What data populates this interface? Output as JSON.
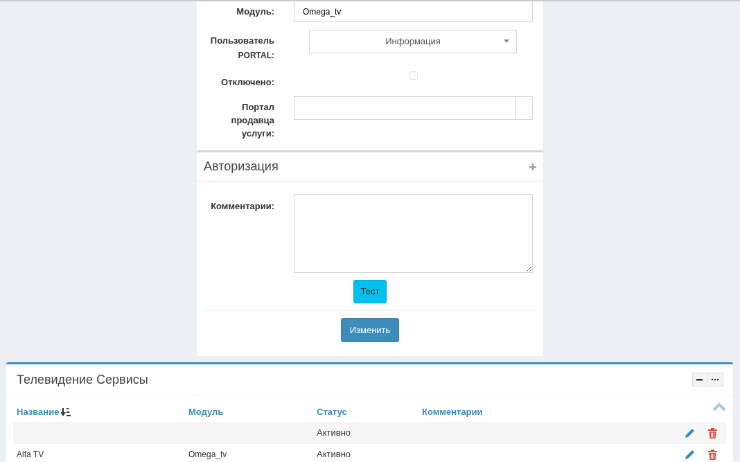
{
  "form": {
    "fields": [
      {
        "kind": "text",
        "label": "Модуль:",
        "value": "Omega_tv"
      },
      {
        "kind": "select",
        "label": "Пользователь",
        "label_note": "PORTAL:",
        "value": "Информация"
      },
      {
        "kind": "checkbox",
        "label": "Отключено:",
        "checked": false
      },
      {
        "kind": "addon",
        "label": "Портал продавца услуги:"
      }
    ],
    "section": {
      "title": "Авторизация",
      "expanded": false
    },
    "comments": {
      "label": "Комментарии:"
    },
    "test_button": "Тест",
    "submit_button": "Изменить"
  },
  "panel": {
    "title": "Телевидение Сервисы",
    "columns": [
      {
        "label": "Название",
        "sorted": true
      },
      {
        "label": "Модуль",
        "sorted": false
      },
      {
        "label": "Статус",
        "sorted": false
      },
      {
        "label": "Комментарии",
        "sorted": false
      }
    ],
    "rows": [
      {
        "cells": [
          "",
          "",
          "Активно",
          ""
        ]
      },
      {
        "cells": [
          "Alfa TV",
          "Omega_tv",
          "Активно",
          ""
        ]
      }
    ]
  }
}
